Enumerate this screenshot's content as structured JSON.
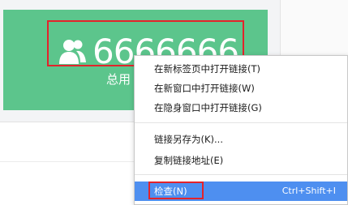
{
  "card": {
    "value": "6666666",
    "caption": "总用",
    "color": "#5cc58c"
  },
  "icons": {
    "user": "user-icon"
  },
  "context_menu": {
    "items": [
      {
        "label": "在新标签页中打开链接(T)"
      },
      {
        "label": "在新窗口中打开链接(W)"
      },
      {
        "label": "在隐身窗口中打开链接(G)"
      },
      {
        "label": "链接另存为(K)..."
      },
      {
        "label": "复制链接地址(E)"
      },
      {
        "label": "检查(N)",
        "shortcut": "Ctrl+Shift+I"
      }
    ],
    "selected_color": "#4e8ff0"
  },
  "highlight_color": "#e3232b"
}
